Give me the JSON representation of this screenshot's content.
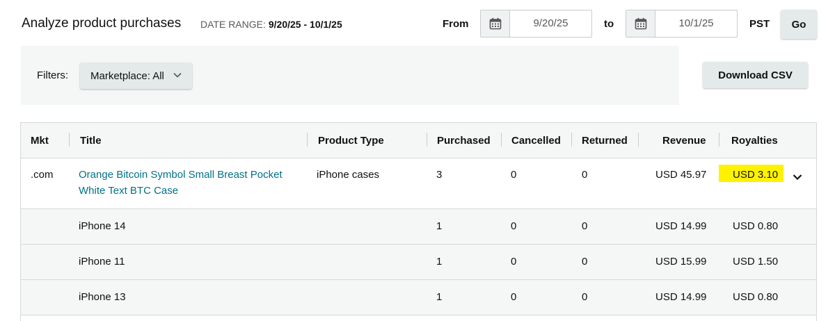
{
  "header": {
    "title": "Analyze product purchases",
    "date_range_label": "DATE RANGE:",
    "date_range_value": "9/20/25 - 10/1/25",
    "from_label": "From",
    "from_date": "9/20/25",
    "to_label": "to",
    "to_date": "10/1/25",
    "timezone": "PST",
    "go_label": "Go"
  },
  "filters": {
    "label": "Filters:",
    "marketplace": "Marketplace: All",
    "download_label": "Download CSV"
  },
  "table": {
    "columns": [
      "Mkt",
      "Title",
      "Product Type",
      "Purchased",
      "Cancelled",
      "Returned",
      "Revenue",
      "Royalties"
    ],
    "main_row": {
      "mkt": ".com",
      "title": "Orange Bitcoin Symbol Small Breast Pocket White Text BTC Case",
      "product_type": "iPhone cases",
      "purchased": "3",
      "cancelled": "0",
      "returned": "0",
      "revenue": "USD 45.97",
      "royalties": "USD 3.10"
    },
    "sub_rows": [
      {
        "title": "iPhone 14",
        "purchased": "1",
        "cancelled": "0",
        "returned": "0",
        "revenue": "USD 14.99",
        "royalties": "USD 0.80"
      },
      {
        "title": "iPhone 11",
        "purchased": "1",
        "cancelled": "0",
        "returned": "0",
        "revenue": "USD 15.99",
        "royalties": "USD 1.50"
      },
      {
        "title": "iPhone 13",
        "purchased": "1",
        "cancelled": "0",
        "returned": "0",
        "revenue": "USD 14.99",
        "royalties": "USD 0.80"
      }
    ]
  },
  "colors": {
    "link": "#007185",
    "highlight": "#fff200",
    "panel_bg": "#f5f7f7",
    "button_bg": "#e4eaea"
  },
  "icons": {
    "calendar": "calendar-icon",
    "dropdown": "chevron-down-icon",
    "expand": "chevron-down-icon"
  }
}
